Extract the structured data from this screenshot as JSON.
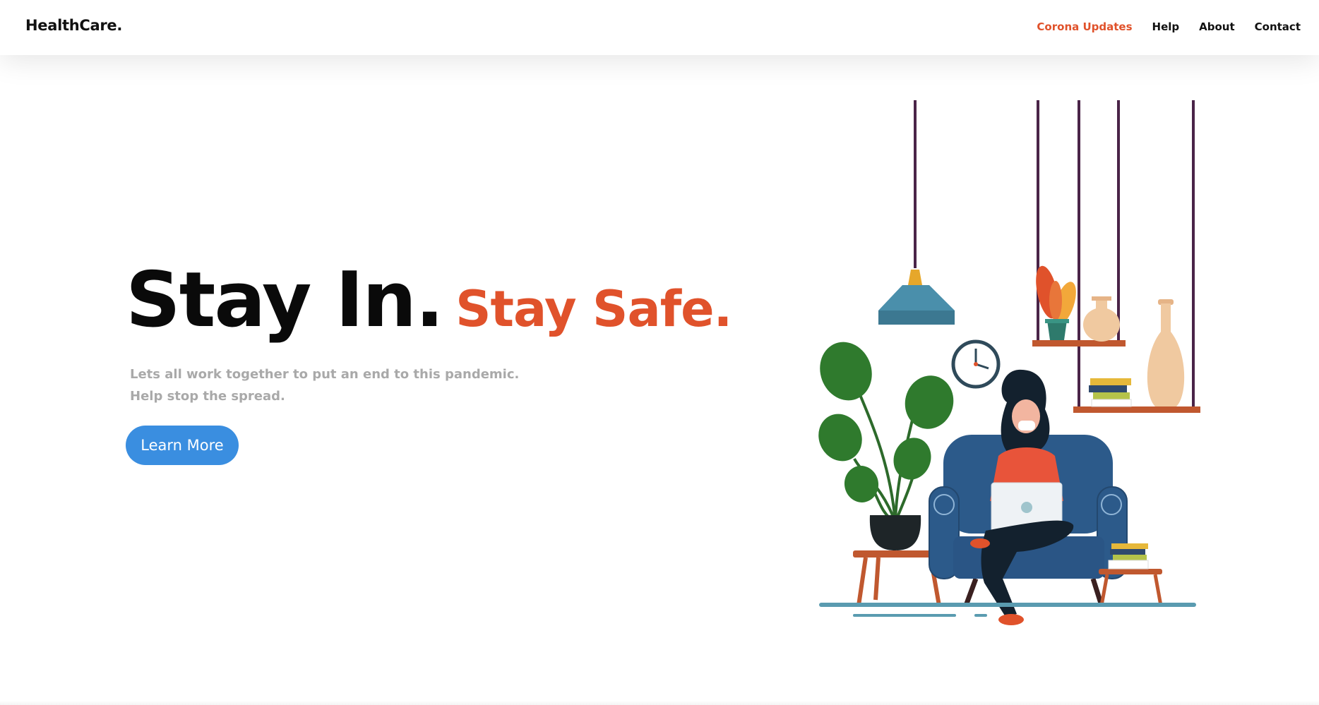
{
  "header": {
    "logo": "HealthCare.",
    "nav": [
      {
        "label": "Corona Updates",
        "active": true
      },
      {
        "label": "Help",
        "active": false
      },
      {
        "label": "About",
        "active": false
      },
      {
        "label": "Contact",
        "active": false
      }
    ]
  },
  "hero": {
    "title_main": "Stay In.",
    "title_accent": "Stay Safe.",
    "subtitle_line1": "Lets all work together to put an end to this pandemic.",
    "subtitle_line2": "Help stop the spread.",
    "cta_label": "Learn More"
  },
  "colors": {
    "accent": "#e0522b",
    "cta": "#3a8ee0",
    "subtitle": "#a9a9a9"
  },
  "illustration": {
    "description_icons": [
      "pendant-lamp-icon",
      "wall-clock-icon",
      "monstera-plant-icon",
      "armchair-icon",
      "woman-with-laptop-icon",
      "shelf-icon",
      "vase-icon",
      "books-icon",
      "side-table-icon"
    ]
  }
}
